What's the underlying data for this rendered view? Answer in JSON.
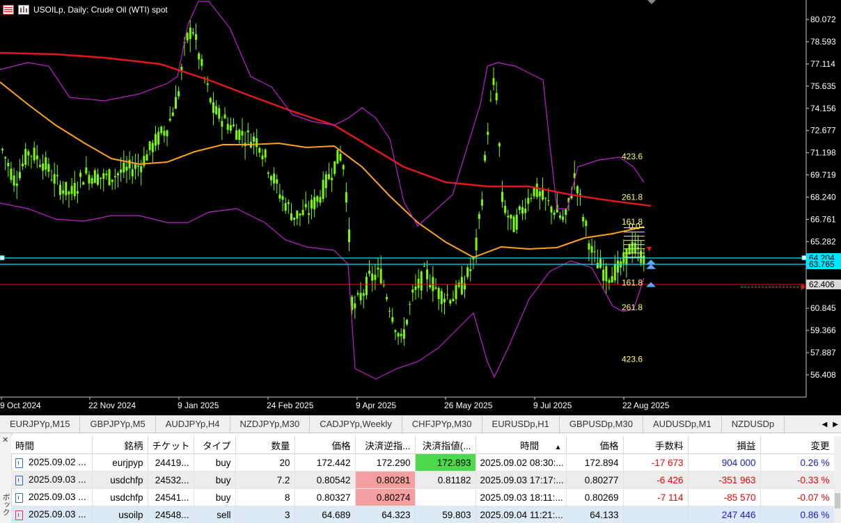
{
  "chart": {
    "title": "USOILp, Daily:  Crude Oil (WTI) spot",
    "price_ticks": [
      "80.072",
      "78.593",
      "77.114",
      "75.635",
      "74.156",
      "72.677",
      "71.198",
      "69.719",
      "68.240",
      "66.761",
      "65.282",
      "63.803",
      "62.324",
      "60.845",
      "59.366",
      "57.887",
      "56.408"
    ],
    "date_ticks": [
      "9 Oct 2024",
      "22 Nov 2024",
      "9 Jan 2025",
      "24 Feb 2025",
      "9 Apr 2025",
      "26 May 2025",
      "9 Jul 2025",
      "22 Aug 2025"
    ],
    "price_labels": [
      {
        "text": "64.204",
        "value": 64.204,
        "bg": "#00e5ff",
        "fg": "#000000"
      },
      {
        "text": "63.765",
        "value": 63.765,
        "bg": "#00e5ff",
        "fg": "#000000"
      },
      {
        "text": "62.406",
        "value": 62.406,
        "bg": "#d9d9d9",
        "fg": "#000000"
      }
    ],
    "fib_levels": [
      {
        "text": "423.6",
        "value": 70.95
      },
      {
        "text": "261.8",
        "value": 68.25
      },
      {
        "text": "161.8",
        "value": 66.6
      },
      {
        "text": "0.0",
        "value": 66.3
      },
      {
        "text": "161.8",
        "value": 62.55
      },
      {
        "text": "261.8",
        "value": 60.9
      },
      {
        "text": "423.6",
        "value": 57.45
      }
    ],
    "colors": {
      "candle": "#7cfc00",
      "ma_long": "#e0191a",
      "ma_short": "#ffa31a",
      "bands": "#c11ed1",
      "hline_cyan": "#00e5ff",
      "hline_red": "#e0191a",
      "fib": "#ffff66"
    }
  },
  "tabs": [
    "EURJPYp,M15",
    "GBPJPYp,M5",
    "AUDJPYp,H4",
    "NZDJPYp,M30",
    "CADJPYp,Weekly",
    "CHFJPYp,M30",
    "EURUSDp,H1",
    "GBPUSDp,M30",
    "AUDUSDp,M1",
    "NZDUSDp"
  ],
  "terminal": {
    "side_label": "ボックス",
    "columns": [
      "時間",
      "銘柄",
      "チケット",
      "タイプ",
      "数量",
      "価格",
      "決済逆指...",
      "決済指値(...",
      "時間",
      "価格",
      "手数料",
      "損益",
      "変更"
    ],
    "sort_indicator": "▲",
    "rows": [
      {
        "time": "2025.09.02 ...",
        "symbol": "eurjpyp",
        "ticket": "24419...",
        "type": "buy",
        "volume": "20",
        "price": "172.442",
        "sl": "172.290",
        "tp": "172.893",
        "time2": "2025.09.02 08:30:...",
        "price2": "172.894",
        "commission": "-17 673",
        "profit": "904 000",
        "change": "0.26 %"
      },
      {
        "time": "2025.09.03 ...",
        "symbol": "usdchfp",
        "ticket": "24532...",
        "type": "buy",
        "volume": "7.2",
        "price": "0.80542",
        "sl": "0.80281",
        "tp": "0.81182",
        "time2": "2025.09.03 17:17:...",
        "price2": "0.80277",
        "commission": "-6 426",
        "profit": "-351 963",
        "change": "-0.33 %"
      },
      {
        "time": "2025.09.03 ...",
        "symbol": "usdchfp",
        "ticket": "24541...",
        "type": "buy",
        "volume": "8",
        "price": "0.80327",
        "sl": "0.80274",
        "tp": "",
        "time2": "2025.09.03 18:11:...",
        "price2": "0.80269",
        "commission": "-7 114",
        "profit": "-85 570",
        "change": "-0.07 %"
      },
      {
        "time": "2025.09.03 ...",
        "symbol": "usoilp",
        "ticket": "24548...",
        "type": "sell",
        "volume": "3",
        "price": "64.689",
        "sl": "64.323",
        "tp": "59.803",
        "time2": "2025.09.04 11:21:...",
        "price2": "64.133",
        "commission": "",
        "profit": "247 446",
        "change": "0.86 %"
      }
    ]
  }
}
